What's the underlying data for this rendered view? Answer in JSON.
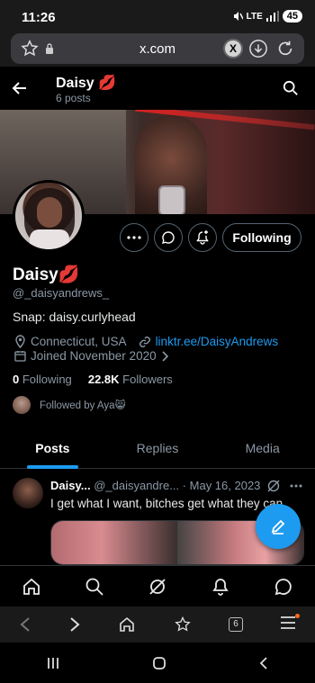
{
  "status_bar": {
    "time": "11:26",
    "network": "LTE",
    "battery": "45"
  },
  "browser": {
    "url": "x.com",
    "tab_count": "6"
  },
  "header": {
    "name": "Daisy",
    "name_emoji": "💋",
    "posts_count": "6 posts"
  },
  "profile": {
    "display_name": "Daisy",
    "name_emoji": "💋",
    "handle": "@_daisyandrews_",
    "bio": "Snap: daisy.curlyhead",
    "location": "Connecticut, USA",
    "website": "linktr.ee/DaisyAndrews",
    "joined": "Joined November 2020",
    "following_count": "0",
    "following_label": "Following",
    "followers_count": "22.8K",
    "followers_label": "Followers",
    "followed_by": "Followed by Aya😸",
    "following_button": "Following"
  },
  "tabs": [
    {
      "label": "Posts"
    },
    {
      "label": "Replies"
    },
    {
      "label": "Media"
    }
  ],
  "tweet": {
    "name": "Daisy...",
    "handle": "@_daisyandre...",
    "sep": "·",
    "date": "May 16, 2023",
    "text": "I get what I want, bitches get what they can"
  },
  "colors": {
    "accent": "#1d9bf0",
    "background": "#000000",
    "muted": "#8b98a5"
  }
}
